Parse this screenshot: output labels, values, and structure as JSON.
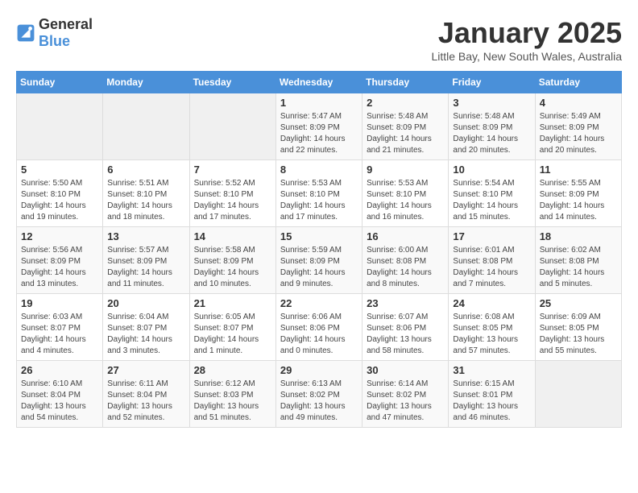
{
  "header": {
    "logo_general": "General",
    "logo_blue": "Blue",
    "title": "January 2025",
    "location": "Little Bay, New South Wales, Australia"
  },
  "weekdays": [
    "Sunday",
    "Monday",
    "Tuesday",
    "Wednesday",
    "Thursday",
    "Friday",
    "Saturday"
  ],
  "weeks": [
    [
      {
        "day": "",
        "info": ""
      },
      {
        "day": "",
        "info": ""
      },
      {
        "day": "",
        "info": ""
      },
      {
        "day": "1",
        "info": "Sunrise: 5:47 AM\nSunset: 8:09 PM\nDaylight: 14 hours\nand 22 minutes."
      },
      {
        "day": "2",
        "info": "Sunrise: 5:48 AM\nSunset: 8:09 PM\nDaylight: 14 hours\nand 21 minutes."
      },
      {
        "day": "3",
        "info": "Sunrise: 5:48 AM\nSunset: 8:09 PM\nDaylight: 14 hours\nand 20 minutes."
      },
      {
        "day": "4",
        "info": "Sunrise: 5:49 AM\nSunset: 8:09 PM\nDaylight: 14 hours\nand 20 minutes."
      }
    ],
    [
      {
        "day": "5",
        "info": "Sunrise: 5:50 AM\nSunset: 8:10 PM\nDaylight: 14 hours\nand 19 minutes."
      },
      {
        "day": "6",
        "info": "Sunrise: 5:51 AM\nSunset: 8:10 PM\nDaylight: 14 hours\nand 18 minutes."
      },
      {
        "day": "7",
        "info": "Sunrise: 5:52 AM\nSunset: 8:10 PM\nDaylight: 14 hours\nand 17 minutes."
      },
      {
        "day": "8",
        "info": "Sunrise: 5:53 AM\nSunset: 8:10 PM\nDaylight: 14 hours\nand 17 minutes."
      },
      {
        "day": "9",
        "info": "Sunrise: 5:53 AM\nSunset: 8:10 PM\nDaylight: 14 hours\nand 16 minutes."
      },
      {
        "day": "10",
        "info": "Sunrise: 5:54 AM\nSunset: 8:10 PM\nDaylight: 14 hours\nand 15 minutes."
      },
      {
        "day": "11",
        "info": "Sunrise: 5:55 AM\nSunset: 8:09 PM\nDaylight: 14 hours\nand 14 minutes."
      }
    ],
    [
      {
        "day": "12",
        "info": "Sunrise: 5:56 AM\nSunset: 8:09 PM\nDaylight: 14 hours\nand 13 minutes."
      },
      {
        "day": "13",
        "info": "Sunrise: 5:57 AM\nSunset: 8:09 PM\nDaylight: 14 hours\nand 11 minutes."
      },
      {
        "day": "14",
        "info": "Sunrise: 5:58 AM\nSunset: 8:09 PM\nDaylight: 14 hours\nand 10 minutes."
      },
      {
        "day": "15",
        "info": "Sunrise: 5:59 AM\nSunset: 8:09 PM\nDaylight: 14 hours\nand 9 minutes."
      },
      {
        "day": "16",
        "info": "Sunrise: 6:00 AM\nSunset: 8:08 PM\nDaylight: 14 hours\nand 8 minutes."
      },
      {
        "day": "17",
        "info": "Sunrise: 6:01 AM\nSunset: 8:08 PM\nDaylight: 14 hours\nand 7 minutes."
      },
      {
        "day": "18",
        "info": "Sunrise: 6:02 AM\nSunset: 8:08 PM\nDaylight: 14 hours\nand 5 minutes."
      }
    ],
    [
      {
        "day": "19",
        "info": "Sunrise: 6:03 AM\nSunset: 8:07 PM\nDaylight: 14 hours\nand 4 minutes."
      },
      {
        "day": "20",
        "info": "Sunrise: 6:04 AM\nSunset: 8:07 PM\nDaylight: 14 hours\nand 3 minutes."
      },
      {
        "day": "21",
        "info": "Sunrise: 6:05 AM\nSunset: 8:07 PM\nDaylight: 14 hours\nand 1 minute."
      },
      {
        "day": "22",
        "info": "Sunrise: 6:06 AM\nSunset: 8:06 PM\nDaylight: 14 hours\nand 0 minutes."
      },
      {
        "day": "23",
        "info": "Sunrise: 6:07 AM\nSunset: 8:06 PM\nDaylight: 13 hours\nand 58 minutes."
      },
      {
        "day": "24",
        "info": "Sunrise: 6:08 AM\nSunset: 8:05 PM\nDaylight: 13 hours\nand 57 minutes."
      },
      {
        "day": "25",
        "info": "Sunrise: 6:09 AM\nSunset: 8:05 PM\nDaylight: 13 hours\nand 55 minutes."
      }
    ],
    [
      {
        "day": "26",
        "info": "Sunrise: 6:10 AM\nSunset: 8:04 PM\nDaylight: 13 hours\nand 54 minutes."
      },
      {
        "day": "27",
        "info": "Sunrise: 6:11 AM\nSunset: 8:04 PM\nDaylight: 13 hours\nand 52 minutes."
      },
      {
        "day": "28",
        "info": "Sunrise: 6:12 AM\nSunset: 8:03 PM\nDaylight: 13 hours\nand 51 minutes."
      },
      {
        "day": "29",
        "info": "Sunrise: 6:13 AM\nSunset: 8:02 PM\nDaylight: 13 hours\nand 49 minutes."
      },
      {
        "day": "30",
        "info": "Sunrise: 6:14 AM\nSunset: 8:02 PM\nDaylight: 13 hours\nand 47 minutes."
      },
      {
        "day": "31",
        "info": "Sunrise: 6:15 AM\nSunset: 8:01 PM\nDaylight: 13 hours\nand 46 minutes."
      },
      {
        "day": "",
        "info": ""
      }
    ]
  ]
}
